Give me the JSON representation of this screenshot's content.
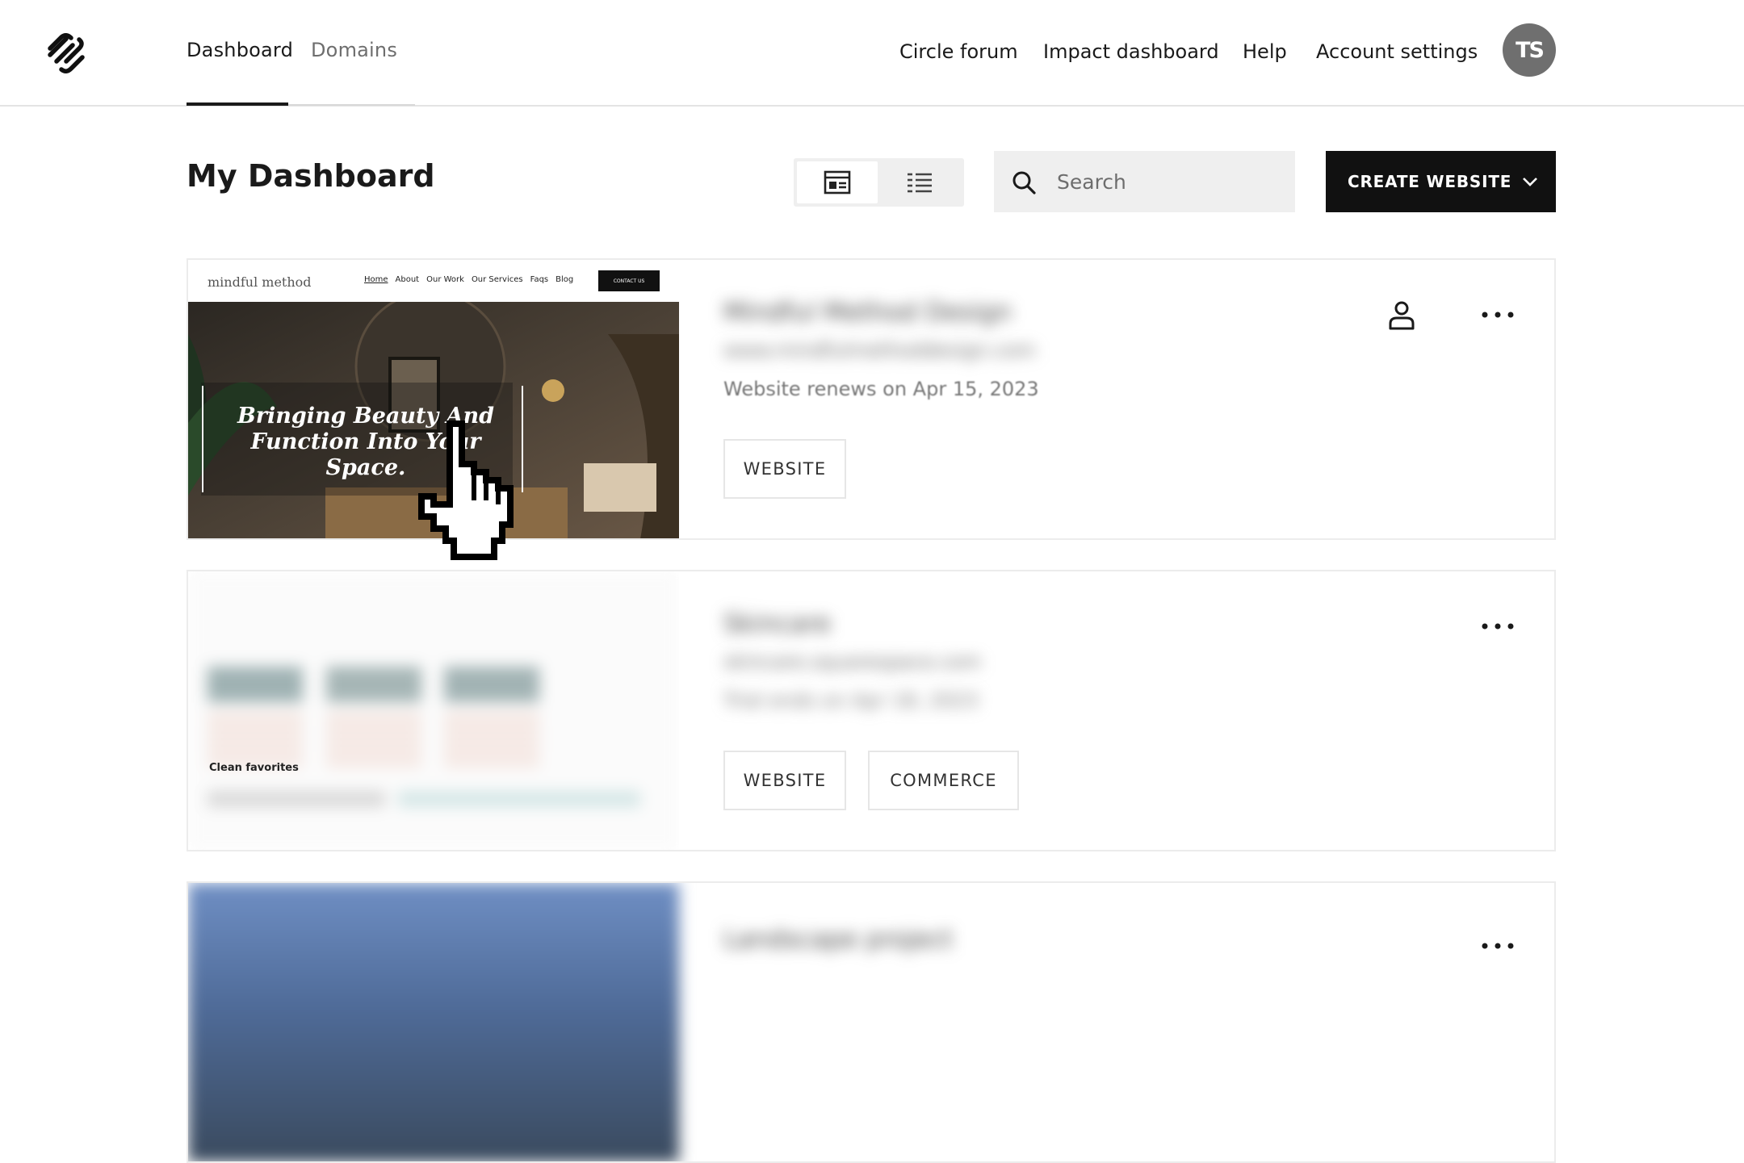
{
  "header": {
    "tabs": [
      {
        "label": "Dashboard",
        "active": true
      },
      {
        "label": "Domains",
        "active": false
      }
    ],
    "links": [
      "Circle forum",
      "Impact dashboard",
      "Help",
      "Account settings"
    ],
    "avatar_initials": "TS"
  },
  "toolbar": {
    "title": "My Dashboard",
    "search_placeholder": "Search",
    "create_label": "CREATE WEBSITE"
  },
  "sites": [
    {
      "name": "Mindful Method Design",
      "url": "www.mindfulmethoddesign.com",
      "renewal": "Website renews on Apr 15, 2023",
      "tags": [
        "WEBSITE"
      ],
      "thumb": {
        "brand": "mindful method",
        "nav": [
          "Home",
          "About",
          "Our Work",
          "Our Services",
          "Faqs",
          "Blog"
        ],
        "cta": "CONTACT US",
        "headline": [
          "Bringing Beauty And",
          "Function Into Your",
          "Space."
        ]
      }
    },
    {
      "name": "Skincare",
      "url": "skincare.squarespace.com",
      "renewal": "Trial ends on Apr 18, 2023",
      "tags": [
        "WEBSITE",
        "COMMERCE"
      ],
      "thumb": {
        "caption": "Clean favorites"
      }
    },
    {
      "name": "Landscape project",
      "tags": []
    }
  ],
  "colors": {
    "accent_dark": "#111111",
    "avatar": "#6f6f6f",
    "search_bg": "#efefef"
  }
}
